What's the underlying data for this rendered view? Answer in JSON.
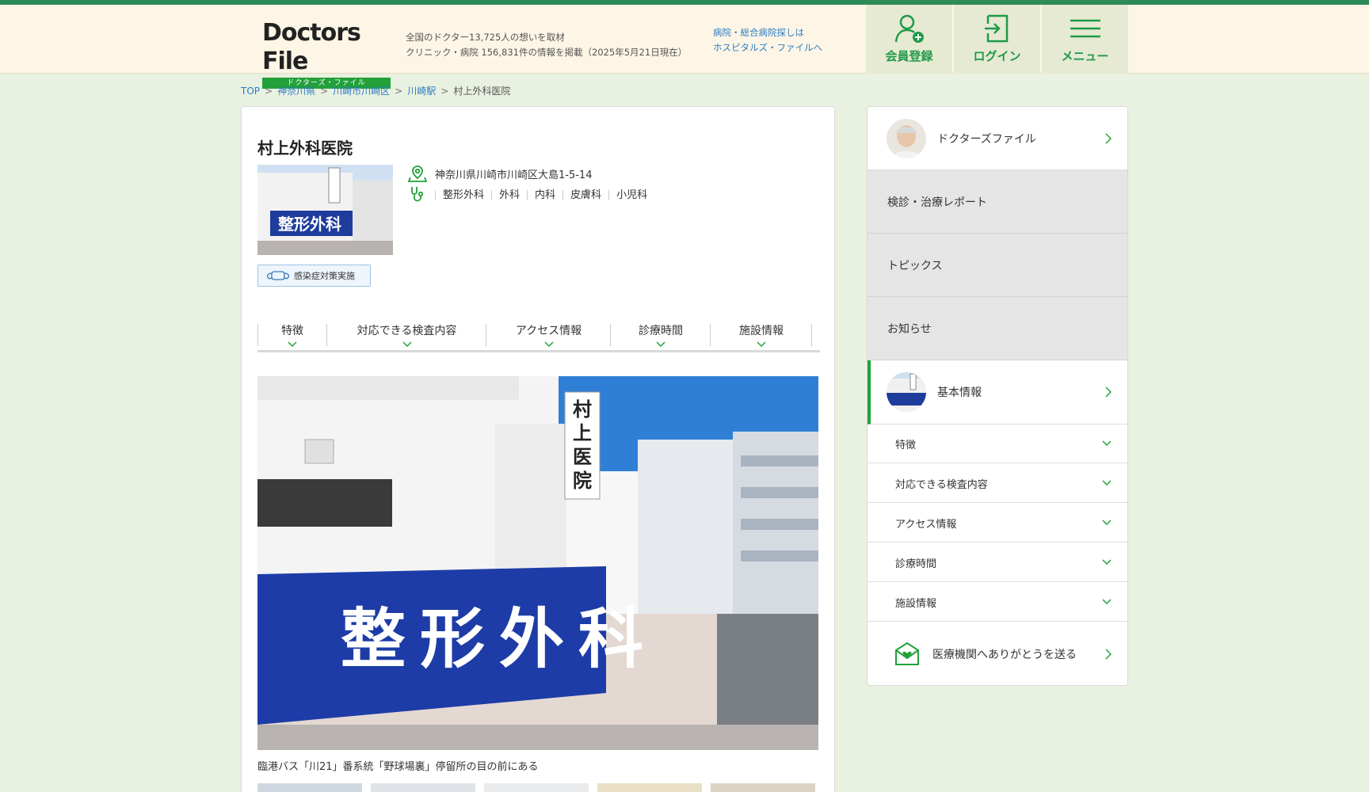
{
  "header": {
    "logo_title": "Doctors File",
    "logo_sub": "ドクターズ・ファイル",
    "tagline_line1": "全国のドクター13,725人の想いを取材",
    "tagline_line2": "クリニック・病院 156,831件の情報を掲載（2025年5月21日現在）",
    "hosp_line1": "病院・総合病院探しは",
    "hosp_line2": "ホスピタルズ・ファイルへ",
    "register_label": "会員登録",
    "login_label": "ログイン",
    "menu_label": "メニュー"
  },
  "breadcrumb": {
    "items": [
      "TOP",
      "神奈川県",
      "川崎市川崎区",
      "川崎駅"
    ],
    "separator": ">",
    "current": "村上外科医院"
  },
  "clinic": {
    "name": "村上外科医院",
    "address": "神奈川県川崎市川崎区大島1-5-14",
    "departments": [
      "整形外科",
      "外科",
      "内科",
      "皮膚科",
      "小児科"
    ],
    "badge": "感染症対策実施",
    "photo_banner_text": "整形外科",
    "photo_sign_text": "村上医院",
    "photo_caption": "臨港バス「川21」番系統「野球場裏」停留所の目の前にある"
  },
  "tabs": [
    "特徴",
    "対応できる検査内容",
    "アクセス情報",
    "診療時間",
    "施設情報"
  ],
  "sidebar": {
    "doctors_file": "ドクターズファイル",
    "report": "検診・治療レポート",
    "topics": "トピックス",
    "news": "お知らせ",
    "basic_info": "基本情報",
    "sub_items": [
      "特徴",
      "対応できる検査内容",
      "アクセス情報",
      "診療時間",
      "施設情報"
    ],
    "thanks": "医療機関へありがとうを送る"
  },
  "colors": {
    "brand_green": "#22a03a",
    "link_blue": "#2d7cc4",
    "background": "#e9f1e1",
    "header_bg": "#fdf6e6"
  }
}
